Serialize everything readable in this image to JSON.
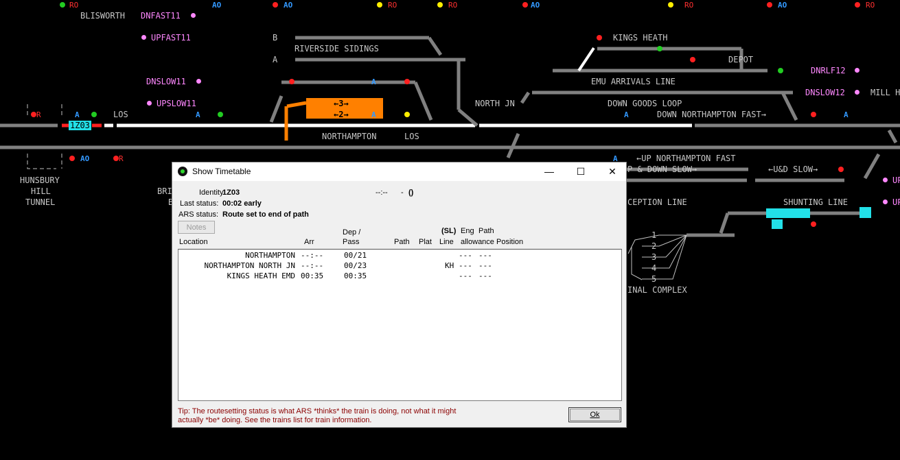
{
  "board": {
    "labels": {
      "blisworth": "BLISWORTH",
      "dnfast11": "DNFAST11",
      "upfast11": "UPFAST11",
      "dnslow11": "DNSLOW11",
      "upslow11": "UPSLOW11",
      "b": "B",
      "a": "A",
      "riverside_sidings": "RIVERSIDE SIDINGS",
      "kings_heath": "KINGS HEATH",
      "depot": "DEPOT",
      "dnrlf12": "DNRLF12",
      "dnslow12": "DNSLOW12",
      "mill": "MILL H",
      "emu_arrivals": "EMU ARRIVALS LINE",
      "down_goods_loop": "DOWN GOODS LOOP",
      "north_jn": "NORTH JN",
      "down_northampton_fast": "DOWN NORTHAMPTON FAST→",
      "los_left": "LOS",
      "northampton": "NORTHAMPTON",
      "los_mid": "LOS",
      "up_northampton_fast": "←UP NORTHAMPTON FAST",
      "up_down_slow": "P & DOWN SLOW→",
      "ud_slow": "←U&D SLOW→",
      "reception_line": "CEPTION LINE",
      "shunting_line": "SHUNTING LINE",
      "terminal_complex": "INAL COMPLEX",
      "hunsbury1": "HUNSBURY",
      "hunsbury2": "HILL",
      "hunsbury3": "TUNNEL",
      "bri1": "BRI",
      "bri2": "B",
      "up_right1": "UP",
      "up_right2": "UP",
      "plat3": "←3→",
      "plat2": "←2→",
      "siding1": "1",
      "siding2": "2",
      "siding3": "3",
      "siding4": "4",
      "siding5": "5",
      "berth_1z03": "1Z03"
    },
    "signal_text": {
      "ro": "RO",
      "ao": "AO",
      "a": "A",
      "r": "R",
      "o": "O"
    },
    "colors": {
      "track": "#808080",
      "track_set": "#ffffff",
      "route_occupied": "#ff8000",
      "berth": "#22e0e8",
      "signal_red": "#ff2020",
      "signal_green": "#22cc22",
      "signal_yellow": "#ffee00",
      "platform_label": "#ff88ff"
    }
  },
  "dialog": {
    "title": "Show Timetable",
    "icon": "green-led-icon",
    "window_buttons": {
      "minimize": "—",
      "maximize": "☐",
      "close": "✕"
    },
    "identity_label": "Identity:",
    "identity_value": "1Z03",
    "identity_time": "--:--",
    "identity_dash": "-",
    "identity_paren": "()",
    "last_status_label": "Last status:",
    "last_status_value": "00:02  early",
    "ars_status_label": "ARS status:",
    "ars_status_value": "Route set to end of path",
    "notes_button": "Notes",
    "columns": {
      "location": "Location",
      "arr": "Arr",
      "dep_pass_1": "Dep /",
      "dep_pass_2": "Pass",
      "path": "Path",
      "plat": "Plat",
      "sl": "(SL)",
      "line": "Line",
      "eng": "Eng",
      "allowance": "allowance",
      "path_pos_1": "Path",
      "path_pos_2": "Position"
    },
    "rows": [
      {
        "location": "NORTHAMPTON",
        "arr": "--:--",
        "dep": "00/21",
        "line": "",
        "eng": "---",
        "pathpos": "---"
      },
      {
        "location": "NORTHAMPTON NORTH JN",
        "arr": "--:--",
        "dep": "00/23",
        "line": "KH",
        "eng": "---",
        "pathpos": "---"
      },
      {
        "location": "KINGS HEATH EMD",
        "arr": "00:35",
        "dep": "00:35",
        "line": "",
        "eng": "---",
        "pathpos": "---"
      }
    ],
    "tip": "Tip: The routesetting status is what ARS *thinks* the train is doing, not what it might actually *be* doing. See the trains list for train information.",
    "ok_button": "Ok"
  }
}
